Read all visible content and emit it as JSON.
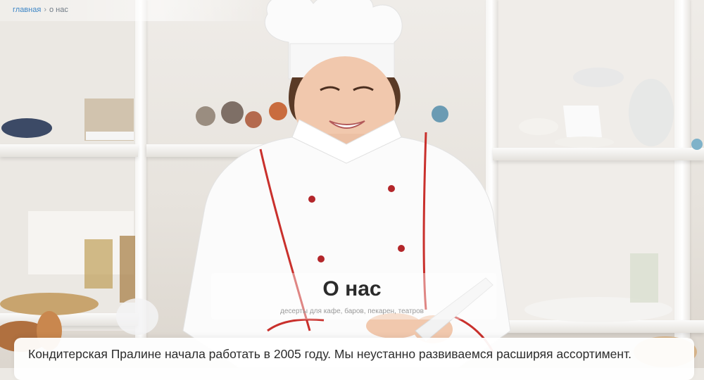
{
  "breadcrumb": {
    "home_label": "главная",
    "separator": "›",
    "current_label": "о нас"
  },
  "page": {
    "title": "О нас",
    "subtitle": "десерты для кафе, баров, пекарен, театров"
  },
  "intro": {
    "text": "Кондитерская Пралине начала работать в 2005 году. Мы неустанно развиваемся расширяя ассортимент."
  },
  "colors": {
    "link": "#3d86c6",
    "title": "#2b2b2b",
    "body_text": "#2c2c2c",
    "card_bg": "#ffffff"
  }
}
